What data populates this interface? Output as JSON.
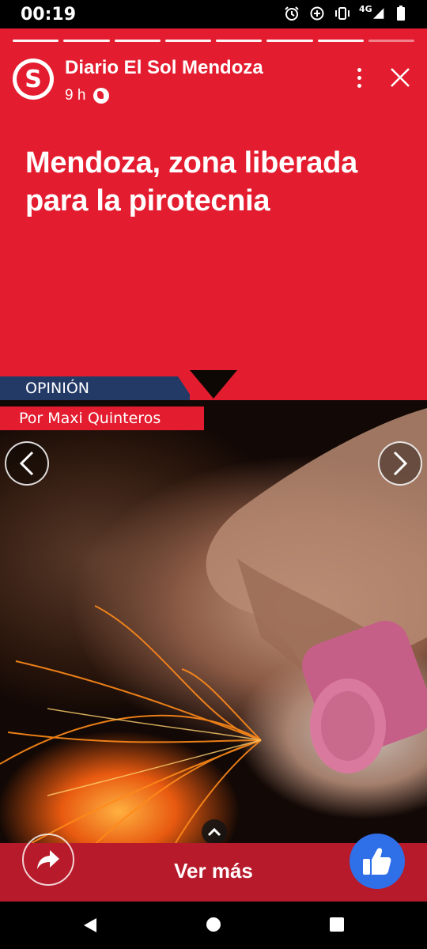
{
  "status_bar": {
    "time": "00:19",
    "network": "4G",
    "icons": [
      "alarm-icon",
      "data-saver-icon",
      "vibrate-icon",
      "signal-icon",
      "battery-icon"
    ]
  },
  "story": {
    "progress": {
      "total_segments": 8,
      "active_segment": 8
    },
    "publisher": {
      "name": "Diario El Sol Mendoza",
      "logo_letter": "S",
      "time": "9 h"
    },
    "headline": "Mendoza, zona liberada para la pirotecnia",
    "section_tag": "OPINIÓN",
    "author": "Por Maxi Quinteros",
    "see_more": "Ver más"
  },
  "colors": {
    "brand_red": "#e31d2f",
    "footer_red": "#b71a2a",
    "section_blue": "#243a66",
    "like_blue": "#2f6fe8"
  }
}
